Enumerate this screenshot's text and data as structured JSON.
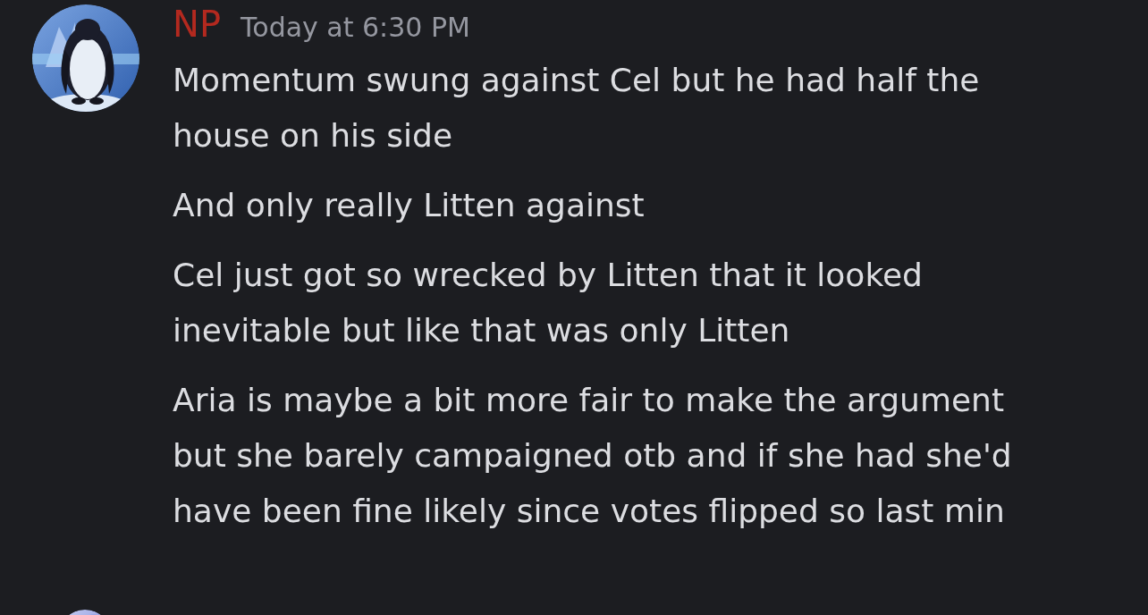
{
  "message": {
    "author": "NP",
    "timestamp": "Today at 6:30 PM",
    "lines": [
      "Momentum swung against Cel but he had half the house on his side",
      "And only really Litten against",
      "Cel just got so wrecked by Litten that it looked inevitable but like that was only Litten",
      "Aria is maybe a bit more fair to make the argument but she barely campaigned otb and if she had she'd have been fine likely since votes flipped so last min"
    ]
  }
}
